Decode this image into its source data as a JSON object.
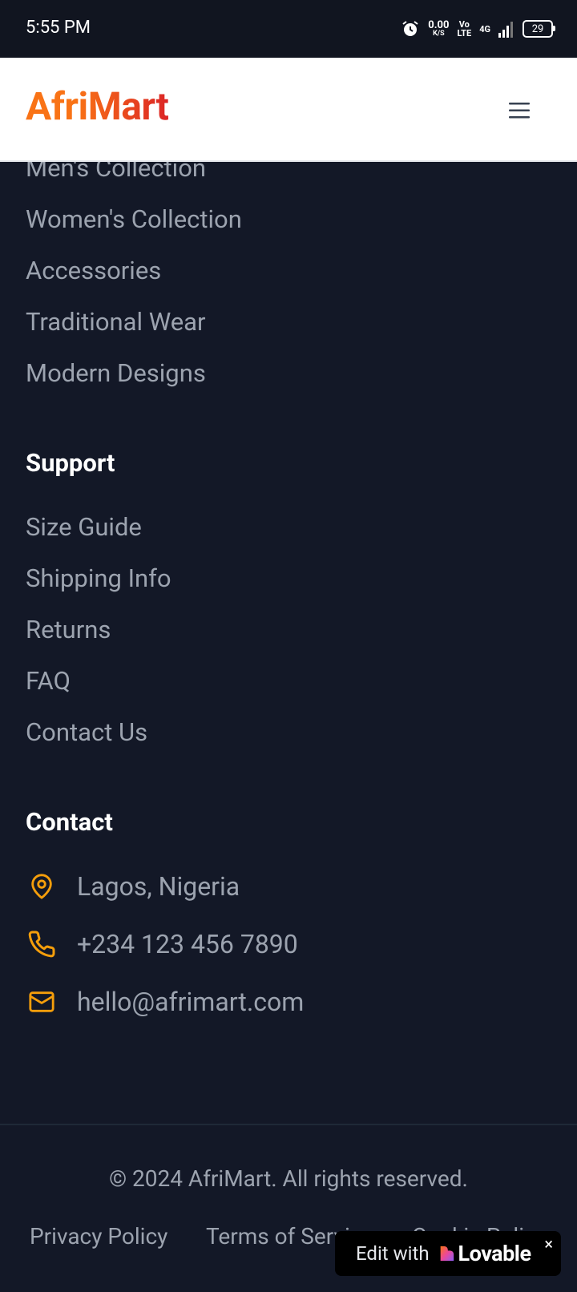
{
  "status_bar": {
    "time": "5:55 PM",
    "net_speed_value": "0.00",
    "net_speed_unit": "K/S",
    "volte_top": "Vo",
    "volte_bottom": "LTE",
    "network": "4G",
    "battery": "29"
  },
  "header": {
    "logo": "AfriMart",
    "colors": {
      "logo_start": "#f97316",
      "logo_end": "#dc2626"
    }
  },
  "collections": {
    "items": [
      {
        "label": "Men's Collection"
      },
      {
        "label": "Women's Collection"
      },
      {
        "label": "Accessories"
      },
      {
        "label": "Traditional Wear"
      },
      {
        "label": "Modern Designs"
      }
    ]
  },
  "support": {
    "heading": "Support",
    "items": [
      {
        "label": "Size Guide"
      },
      {
        "label": "Shipping Info"
      },
      {
        "label": "Returns"
      },
      {
        "label": "FAQ"
      },
      {
        "label": "Contact Us"
      }
    ]
  },
  "contact": {
    "heading": "Contact",
    "location": "Lagos, Nigeria",
    "phone": "+234 123 456 7890",
    "email": "hello@afrimart.com",
    "icon_color": "#f59e0b"
  },
  "footer": {
    "copyright": "© 2024 AfriMart. All rights reserved.",
    "links": [
      {
        "label": "Privacy Policy"
      },
      {
        "label": "Terms of Service"
      },
      {
        "label": "Cookie Policy"
      }
    ]
  },
  "badge": {
    "edit_label": "Edit with",
    "brand": "Lovable",
    "close": "×"
  }
}
